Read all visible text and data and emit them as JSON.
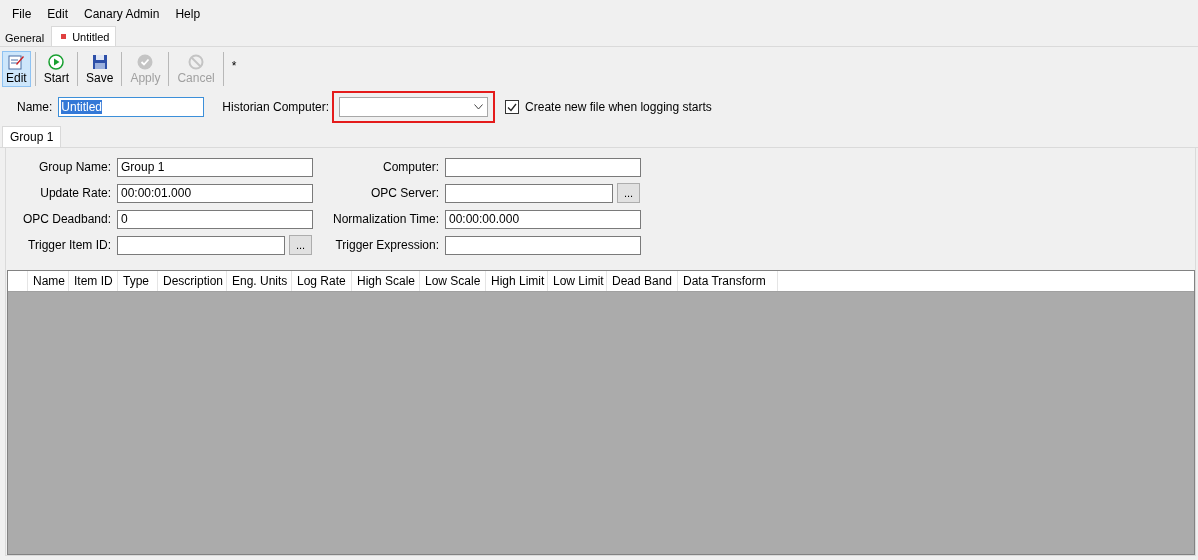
{
  "menu": [
    "File",
    "Edit",
    "Canary Admin",
    "Help"
  ],
  "doc_tabs": [
    {
      "label": "General",
      "selected": false,
      "modified": false
    },
    {
      "label": "Untitled",
      "selected": true,
      "modified": true
    }
  ],
  "toolbar": [
    {
      "label": "Edit",
      "selected": true,
      "disabled": false
    },
    {
      "label": "Start",
      "selected": false,
      "disabled": false
    },
    {
      "label": "Save",
      "selected": false,
      "disabled": false
    },
    {
      "label": "Apply",
      "selected": false,
      "disabled": true
    },
    {
      "label": "Cancel",
      "selected": false,
      "disabled": true
    }
  ],
  "toolbar_mark": "*",
  "name_field": {
    "label": "Name:",
    "value": "Untitled"
  },
  "historian": {
    "label": "Historian Computer:",
    "highlighted": true
  },
  "create_file": {
    "label": "Create new file when logging starts",
    "checked": true
  },
  "group_tabs": [
    {
      "label": "Group 1",
      "selected": true
    }
  ],
  "left_fields": [
    {
      "label": "Group Name:",
      "value": "Group 1"
    },
    {
      "label": "Update Rate:",
      "value": "00:00:01.000"
    },
    {
      "label": "OPC Deadband:",
      "value": "0"
    },
    {
      "label": "Trigger Item ID:",
      "browse_label": "..."
    }
  ],
  "right_fields": [
    {
      "label": "Computer:"
    },
    {
      "label": "OPC Server:",
      "browse_label": "..."
    },
    {
      "label": "Normalization Time:",
      "value": "00:00:00.000"
    },
    {
      "label": "Trigger Expression:"
    }
  ],
  "table": {
    "columns": [
      "Name",
      "Item ID",
      "Type",
      "Description",
      "Eng. Units",
      "Log Rate",
      "High Scale",
      "Low Scale",
      "High Limit",
      "Low Limit",
      "Dead Band",
      "Data Transform"
    ]
  }
}
